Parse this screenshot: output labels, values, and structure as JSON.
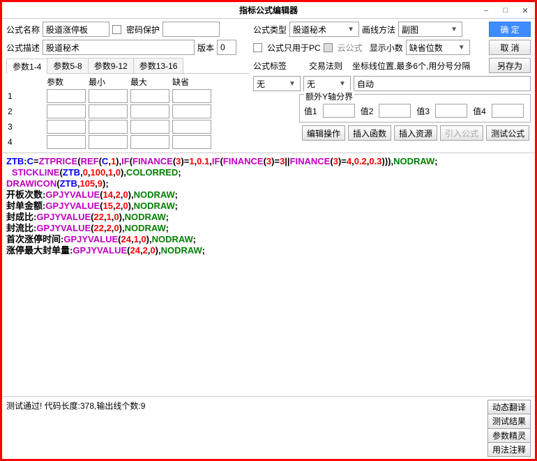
{
  "window": {
    "title": "指标公式编辑器"
  },
  "labels": {
    "name": "公式名称",
    "pwd": "密码保护",
    "type": "公式类型",
    "drawMethod": "画线方法",
    "desc": "公式描述",
    "version": "版本",
    "pcOnly": "公式只用于PC",
    "cloud": "云公式",
    "showDec": "显示小数",
    "tag": "公式标签",
    "tradeRule": "交易法则",
    "coordHint": "坐标线位置,最多6个,用分号分隔",
    "extraY": "额外Y轴分界",
    "y1": "值1",
    "y2": "值2",
    "y3": "值3",
    "y4": "值4",
    "ok": "确 定",
    "cancel": "取 消",
    "saveAs": "另存为",
    "editOp": "编辑操作",
    "insFunc": "插入函数",
    "insRes": "插入资源",
    "importF": "引入公式",
    "testF": "测试公式",
    "dynTrans": "动态翻译",
    "testRes": "测试结果",
    "paramWiz": "参数精灵",
    "usage": "用法注释"
  },
  "values": {
    "name": "股道涨停板",
    "desc": "股道秘术",
    "version": "0",
    "type": "股道秘术",
    "drawMethod": "副图",
    "showDec": "缺省位数",
    "tag": "无",
    "tradeRule": "无",
    "coord": "自动"
  },
  "paramTabs": [
    "参数1-4",
    "参数5-8",
    "参数9-12",
    "参数13-16"
  ],
  "paramHeaders": [
    "参数",
    "最小",
    "最大",
    "缺省"
  ],
  "status": "测试通过! 代码长度:378,输出线个数:9"
}
